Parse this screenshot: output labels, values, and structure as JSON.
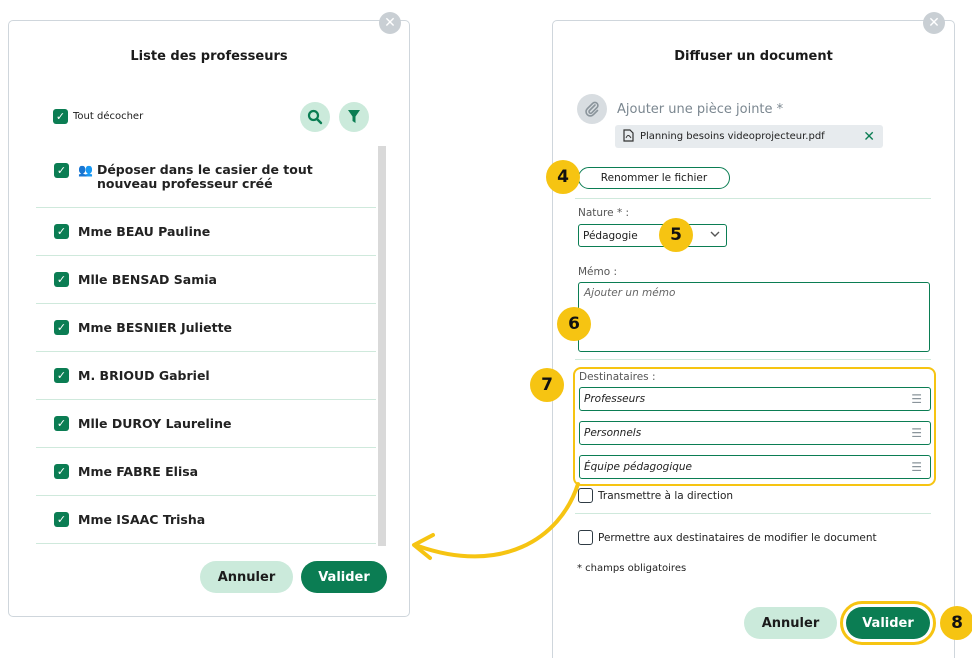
{
  "left_panel": {
    "title": "Liste des professeurs",
    "toggle_all_label": "Tout décocher",
    "icons": {
      "close": "close-icon",
      "search": "search-icon",
      "filter": "filter-icon"
    },
    "deposit_option": "Déposer dans le casier de tout nouveau professeur créé",
    "teachers": [
      {
        "label": "Mme BEAU Pauline",
        "checked": true
      },
      {
        "label": "Mlle BENSAD Samia",
        "checked": true
      },
      {
        "label": "Mme BESNIER Juliette",
        "checked": true
      },
      {
        "label": "M. BRIOUD Gabriel",
        "checked": true
      },
      {
        "label": "Mlle DUROY Laureline",
        "checked": true
      },
      {
        "label": "Mme FABRE Elisa",
        "checked": true
      },
      {
        "label": "Mme ISAAC Trisha",
        "checked": true
      }
    ],
    "cancel_label": "Annuler",
    "validate_label": "Valider"
  },
  "right_panel": {
    "title": "Diffuser un document",
    "attach_label": "Ajouter une pièce jointe *",
    "file_name": "Planning besoins videoprojecteur.pdf",
    "rename_label": "Renommer le fichier",
    "nature_label": "Nature * :",
    "nature_value": "Pédagogie",
    "memo_label": "Mémo :",
    "memo_placeholder": "Ajouter un mémo",
    "recipients_label": "Destinataires :",
    "recipients": [
      "Professeurs",
      "Personnels",
      "Équipe pédagogique"
    ],
    "forward_direction_label": "Transmettre à la direction",
    "allow_edit_label": "Permettre aux destinataires de modifier le document",
    "required_note": "* champs obligatoires",
    "cancel_label": "Annuler",
    "validate_label": "Valider"
  },
  "callouts": [
    "4",
    "5",
    "6",
    "7",
    "8"
  ],
  "colors": {
    "accent": "#0b7d53",
    "accent_light": "#cbeadb",
    "highlight": "#f6c412"
  }
}
